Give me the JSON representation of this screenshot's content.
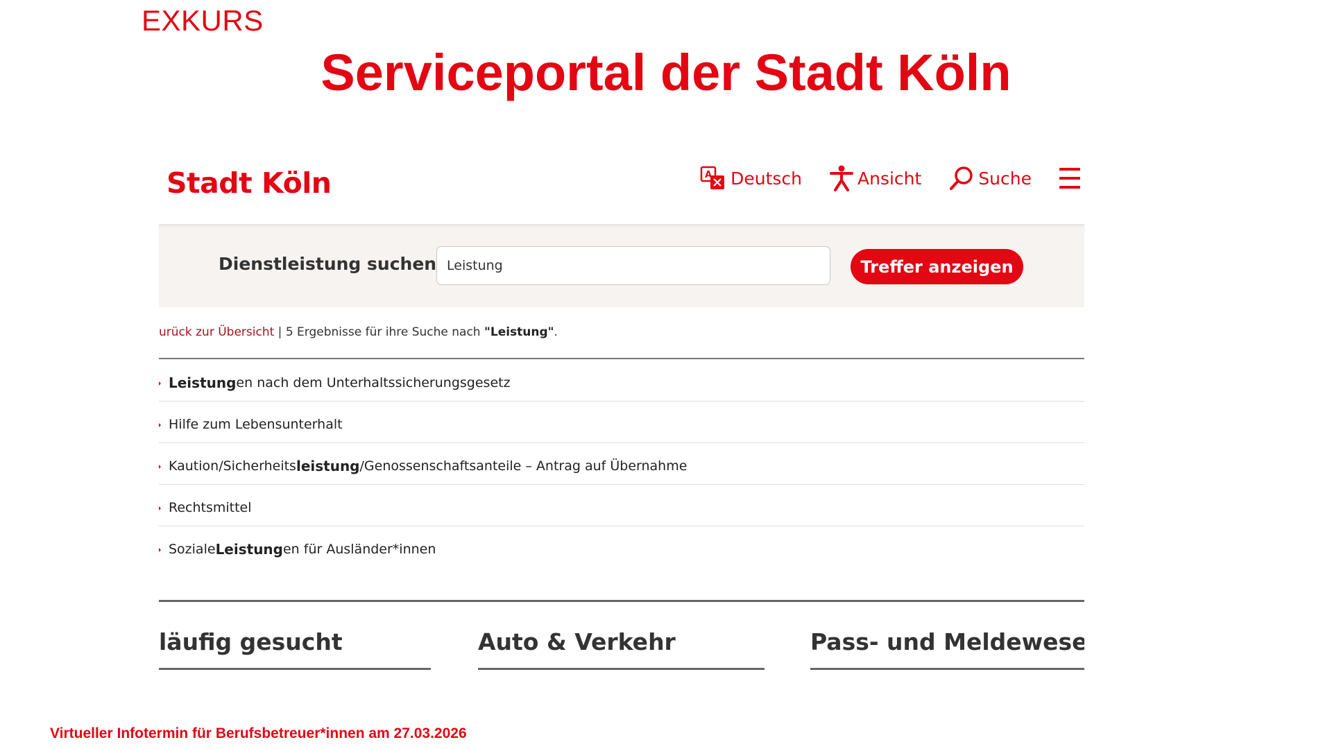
{
  "slide": {
    "label": "EXKURS",
    "title": "Serviceportal der Stadt Köln",
    "footer": "Virtueller Infotermin für Berufsbetreuer*innen am 27.03.2026"
  },
  "site": {
    "logo": "Stadt Köln",
    "nav": {
      "language": "Deutsch",
      "view": "Ansicht",
      "search": "Suche"
    }
  },
  "search": {
    "label": "Dienstleistung suchen:",
    "value": "Leistung",
    "button": "Treffer anzeigen"
  },
  "result_info": {
    "back_link": "urück zur Übersicht",
    "separator": " | ",
    "text_before": "5 Ergebnisse für ihre Suche nach ",
    "query": "\"Leistung\"",
    "text_after": "."
  },
  "results": [
    {
      "pre": "",
      "bold": "Leistung",
      "post": "en nach dem Unterhaltssicherungsgesetz"
    },
    {
      "pre": "Hilfe zum Lebensunterhalt",
      "bold": "",
      "post": ""
    },
    {
      "pre": "Kaution/Sicherheits",
      "bold": "leistung",
      "post": "/Genossenschaftsanteile – Antrag auf Übernahme"
    },
    {
      "pre": "Rechtsmittel",
      "bold": "",
      "post": ""
    },
    {
      "pre": "Soziale ",
      "bold": "Leistung",
      "post": "en für Ausländer*innen"
    }
  ],
  "categories": [
    {
      "label": "läufig gesucht"
    },
    {
      "label": "Auto & Verkehr"
    },
    {
      "label": "Pass- und Meldewesen"
    }
  ],
  "colors": {
    "accent": "#e30613",
    "band": "#f6f3f0",
    "text": "#333333"
  }
}
